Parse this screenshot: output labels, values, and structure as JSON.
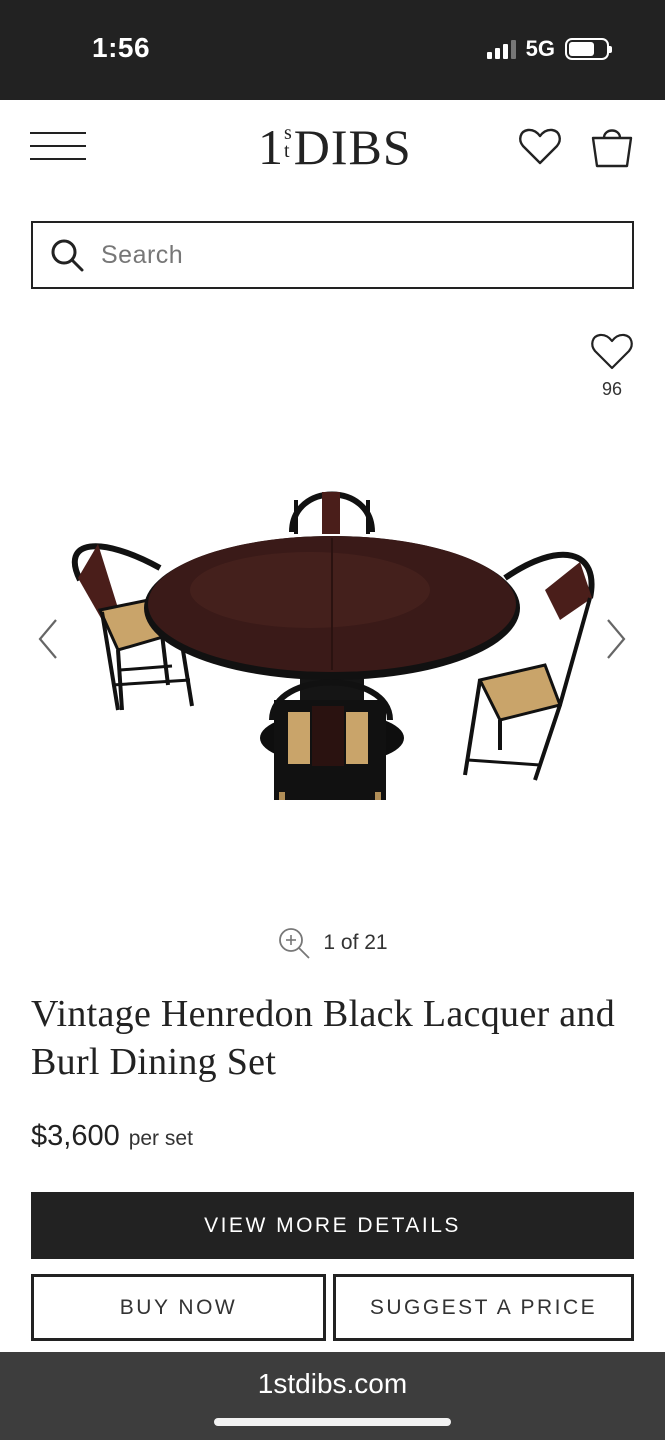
{
  "status_bar": {
    "time": "1:56",
    "network": "5G",
    "signal_bars": 3,
    "battery_level": 0.7
  },
  "header": {
    "logo": "1stDIBS",
    "menu_icon": "hamburger-menu-icon",
    "favorites_icon": "heart-icon",
    "bag_icon": "shopping-bag-icon"
  },
  "search": {
    "placeholder": "Search",
    "value": "",
    "icon": "search-icon"
  },
  "product": {
    "favorite_count": "96",
    "image_counter": "1 of 21",
    "title": "Vintage Henredon Black Lacquer and Burl Dining Set",
    "price": "$3,600",
    "price_unit": "per set"
  },
  "actions": {
    "view_details": "VIEW MORE DETAILS",
    "buy_now": "BUY NOW",
    "suggest_price": "SUGGEST A PRICE"
  },
  "browser": {
    "url": "1stdibs.com"
  },
  "colors": {
    "dark": "#222222",
    "browser_bar": "#3d3d3d",
    "table_wood": "#3a1a18",
    "cane": "#c9a46a"
  }
}
